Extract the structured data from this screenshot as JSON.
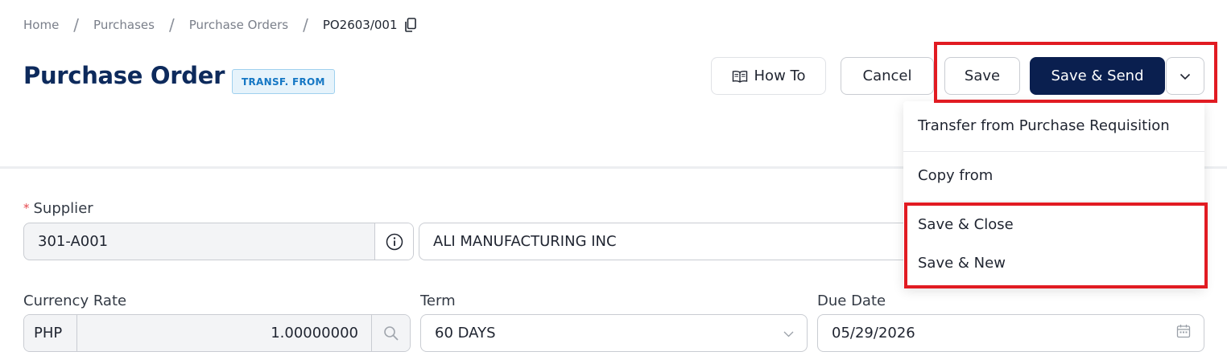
{
  "breadcrumb": {
    "items": [
      "Home",
      "Purchases",
      "Purchase Orders"
    ],
    "separator": "/",
    "current": "PO2603/001"
  },
  "header": {
    "title": "Purchase Order",
    "badge": "TRANSF. FROM",
    "buttons": {
      "how_to": "How To",
      "cancel": "Cancel",
      "save": "Save",
      "save_send": "Save & Send"
    }
  },
  "dropdown": {
    "items": [
      "Transfer from Purchase Requisition",
      "Copy from",
      "Save & Close",
      "Save & New"
    ]
  },
  "form": {
    "supplier": {
      "label": "Supplier",
      "required_mark": "*",
      "code": "301-A001",
      "name": "ALI MANUFACTURING INC"
    },
    "currency_rate": {
      "label": "Currency Rate",
      "currency": "PHP",
      "rate": "1.00000000"
    },
    "term": {
      "label": "Term",
      "value": "60 DAYS"
    },
    "due_date": {
      "label": "Due Date",
      "value": "05/29/2026"
    }
  },
  "colors": {
    "title": "#0d2a5c",
    "primary_button": "#0a1f4f",
    "badge_text": "#1577c4",
    "highlight": "#e11b22"
  }
}
